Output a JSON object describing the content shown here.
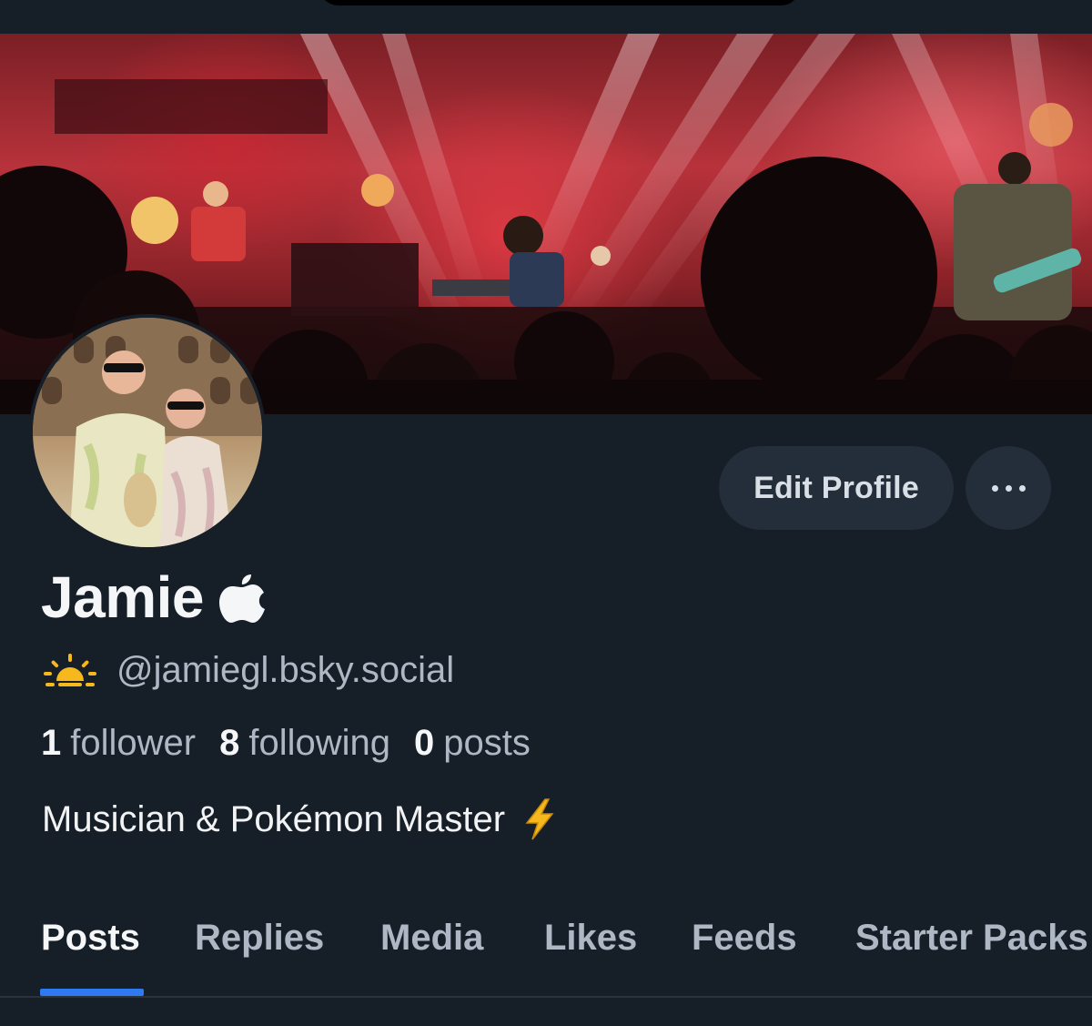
{
  "profile": {
    "display_name": "Jamie",
    "name_emoji": "apple-logo-icon",
    "handle": "@jamiegl.bsky.social",
    "handle_icon": "sunrise-icon",
    "bio": "Musician & Pokémon Master",
    "bio_icon": "lightning-bolt-icon"
  },
  "stats": {
    "followers": {
      "count": "1",
      "label": "follower"
    },
    "following": {
      "count": "8",
      "label": "following"
    },
    "posts": {
      "count": "0",
      "label": "posts"
    }
  },
  "actions": {
    "edit_profile": "Edit Profile",
    "more_icon": "ellipsis-icon"
  },
  "tabs": [
    {
      "label": "Posts",
      "active": true
    },
    {
      "label": "Replies",
      "active": false
    },
    {
      "label": "Media",
      "active": false
    },
    {
      "label": "Likes",
      "active": false
    },
    {
      "label": "Feeds",
      "active": false
    },
    {
      "label": "Starter Packs",
      "active": false
    }
  ],
  "colors": {
    "background": "#161e27",
    "button_bg": "#232e3a",
    "accent": "#2f7af1",
    "muted_text": "#aeb8c4"
  }
}
